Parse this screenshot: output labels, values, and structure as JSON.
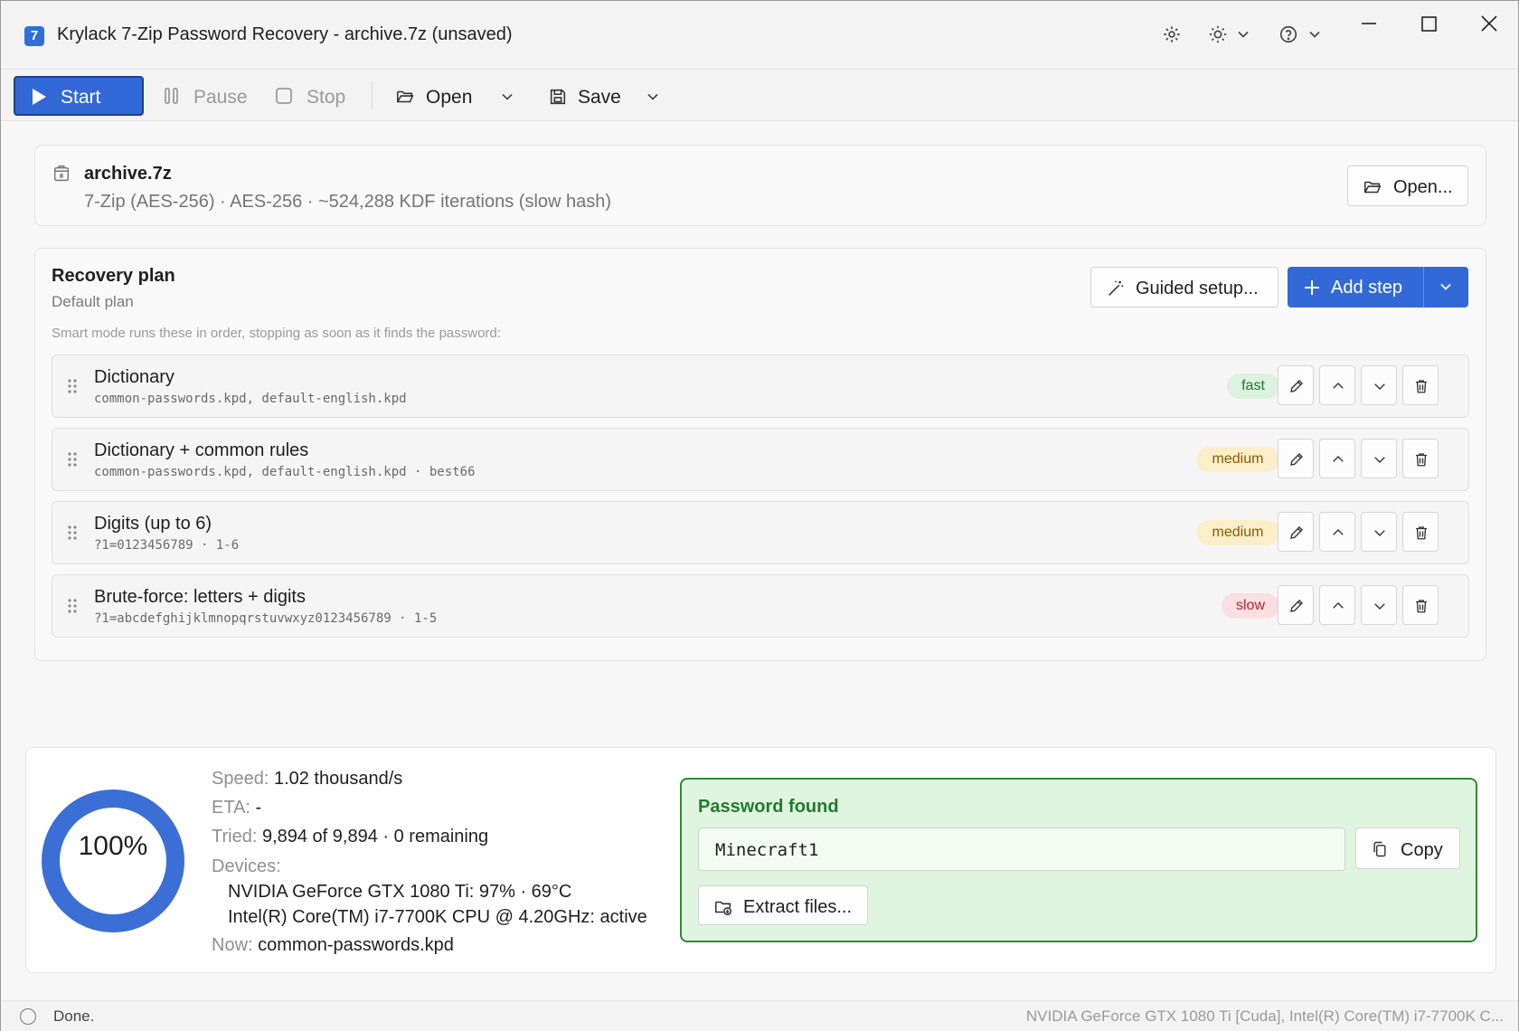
{
  "window": {
    "title": "Krylack 7-Zip Password Recovery - archive.7z (unsaved)",
    "app_icon_glyph": "7",
    "accent_color": "#3369d6"
  },
  "toolbar": {
    "start_label": "Start",
    "pause_label": "Pause",
    "stop_label": "Stop",
    "open_label": "Open",
    "save_label": "Save"
  },
  "file": {
    "name": "archive.7z",
    "meta": "7-Zip (AES-256) · AES-256 · ~524,288 KDF iterations (slow hash)",
    "open_button": "Open..."
  },
  "plan": {
    "title": "Recovery plan",
    "subtitle": "Default plan",
    "hint": "Smart mode runs these in order, stopping as soon as it finds the password:",
    "guided_setup_label": "Guided setup...",
    "add_step_label": "Add step",
    "steps": [
      {
        "name": "Dictionary",
        "detail": "common-passwords.kpd, default-english.kpd",
        "speed": "fast"
      },
      {
        "name": "Dictionary + common rules",
        "detail": "common-passwords.kpd, default-english.kpd · best66",
        "speed": "medium"
      },
      {
        "name": "Digits (up to 6)",
        "detail": "?1=0123456789 · 1-6",
        "speed": "medium"
      },
      {
        "name": "Brute-force: letters + digits",
        "detail": "?1=abcdefghijklmnopqrstuvwxyz0123456789 · 1-5",
        "speed": "slow"
      }
    ]
  },
  "progress": {
    "percent_label": "100%",
    "percent_value": 1.0,
    "speed_key": "Speed:",
    "speed_value": "1.02 thousand/s",
    "eta_key": "ETA:",
    "eta_value": "-",
    "tried_key": "Tried:",
    "tried_value": "9,894 of 9,894 · 0 remaining",
    "devices_key": "Devices:",
    "devices": [
      "NVIDIA GeForce GTX 1080 Ti: 97% · 69°C",
      "Intel(R) Core(TM) i7-7700K CPU @ 4.20GHz: active"
    ],
    "now_key": "Now:",
    "now_value": "common-passwords.kpd"
  },
  "result": {
    "title": "Password found",
    "password": "Minecraft1",
    "copy_label": "Copy",
    "extract_label": "Extract files..."
  },
  "status": {
    "left": "Done.",
    "right": "NVIDIA GeForce GTX 1080 Ti [Cuda], Intel(R) Core(TM) i7-7700K C..."
  }
}
